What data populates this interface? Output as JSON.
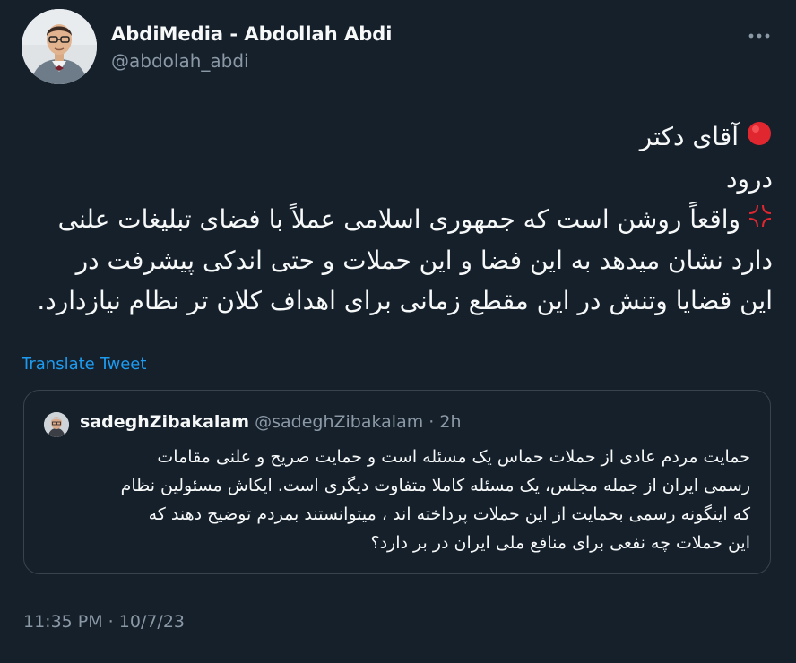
{
  "author": {
    "name": "AbdiMedia - Abdollah Abdi",
    "handle": "@abdolah_abdi"
  },
  "tweet": {
    "lines": [
      "آقای دکتر",
      "درود",
      "واقعاً روشن است که جمهوری اسلامی عملاً با فضای تبلیغات علنی",
      "دارد نشان میدهد به این فضا و این حملات و حتی اندکی پیشرفت در",
      "این قضایا وتنش در این مقطع زمانی برای اهداف کلان تر نظام  نیازدارد."
    ],
    "icons": [
      "red-circle-icon",
      "anger-symbol-icon"
    ]
  },
  "translate_label": "Translate Tweet",
  "quote": {
    "name": "sadeghZibakalam",
    "handle": "@sadeghZibakalam",
    "separator": "·",
    "time": "2h",
    "lines": [
      "حمایت مردم عادی از حملات حماس یک مسئله است و حمایت صریح و علنی مقامات",
      "رسمی ایران از جمله مجلس، یک مسئله کاملا متفاوت دیگری است. ایکاش مسئولین نظام",
      "که اینگونه رسمی بحمایت از این حملات پرداخته اند ، میتوانستند بمردم توضیح دهند که",
      "این حملات چه نفعی برای منافع ملی ایران در بر دارد؟"
    ]
  },
  "timestamp": "11:35 PM · 10/7/23",
  "colors": {
    "background": "#15202b",
    "text": "#f7f9f9",
    "secondary": "#8b98a5",
    "link": "#1d9bf0",
    "border": "#38444d"
  }
}
